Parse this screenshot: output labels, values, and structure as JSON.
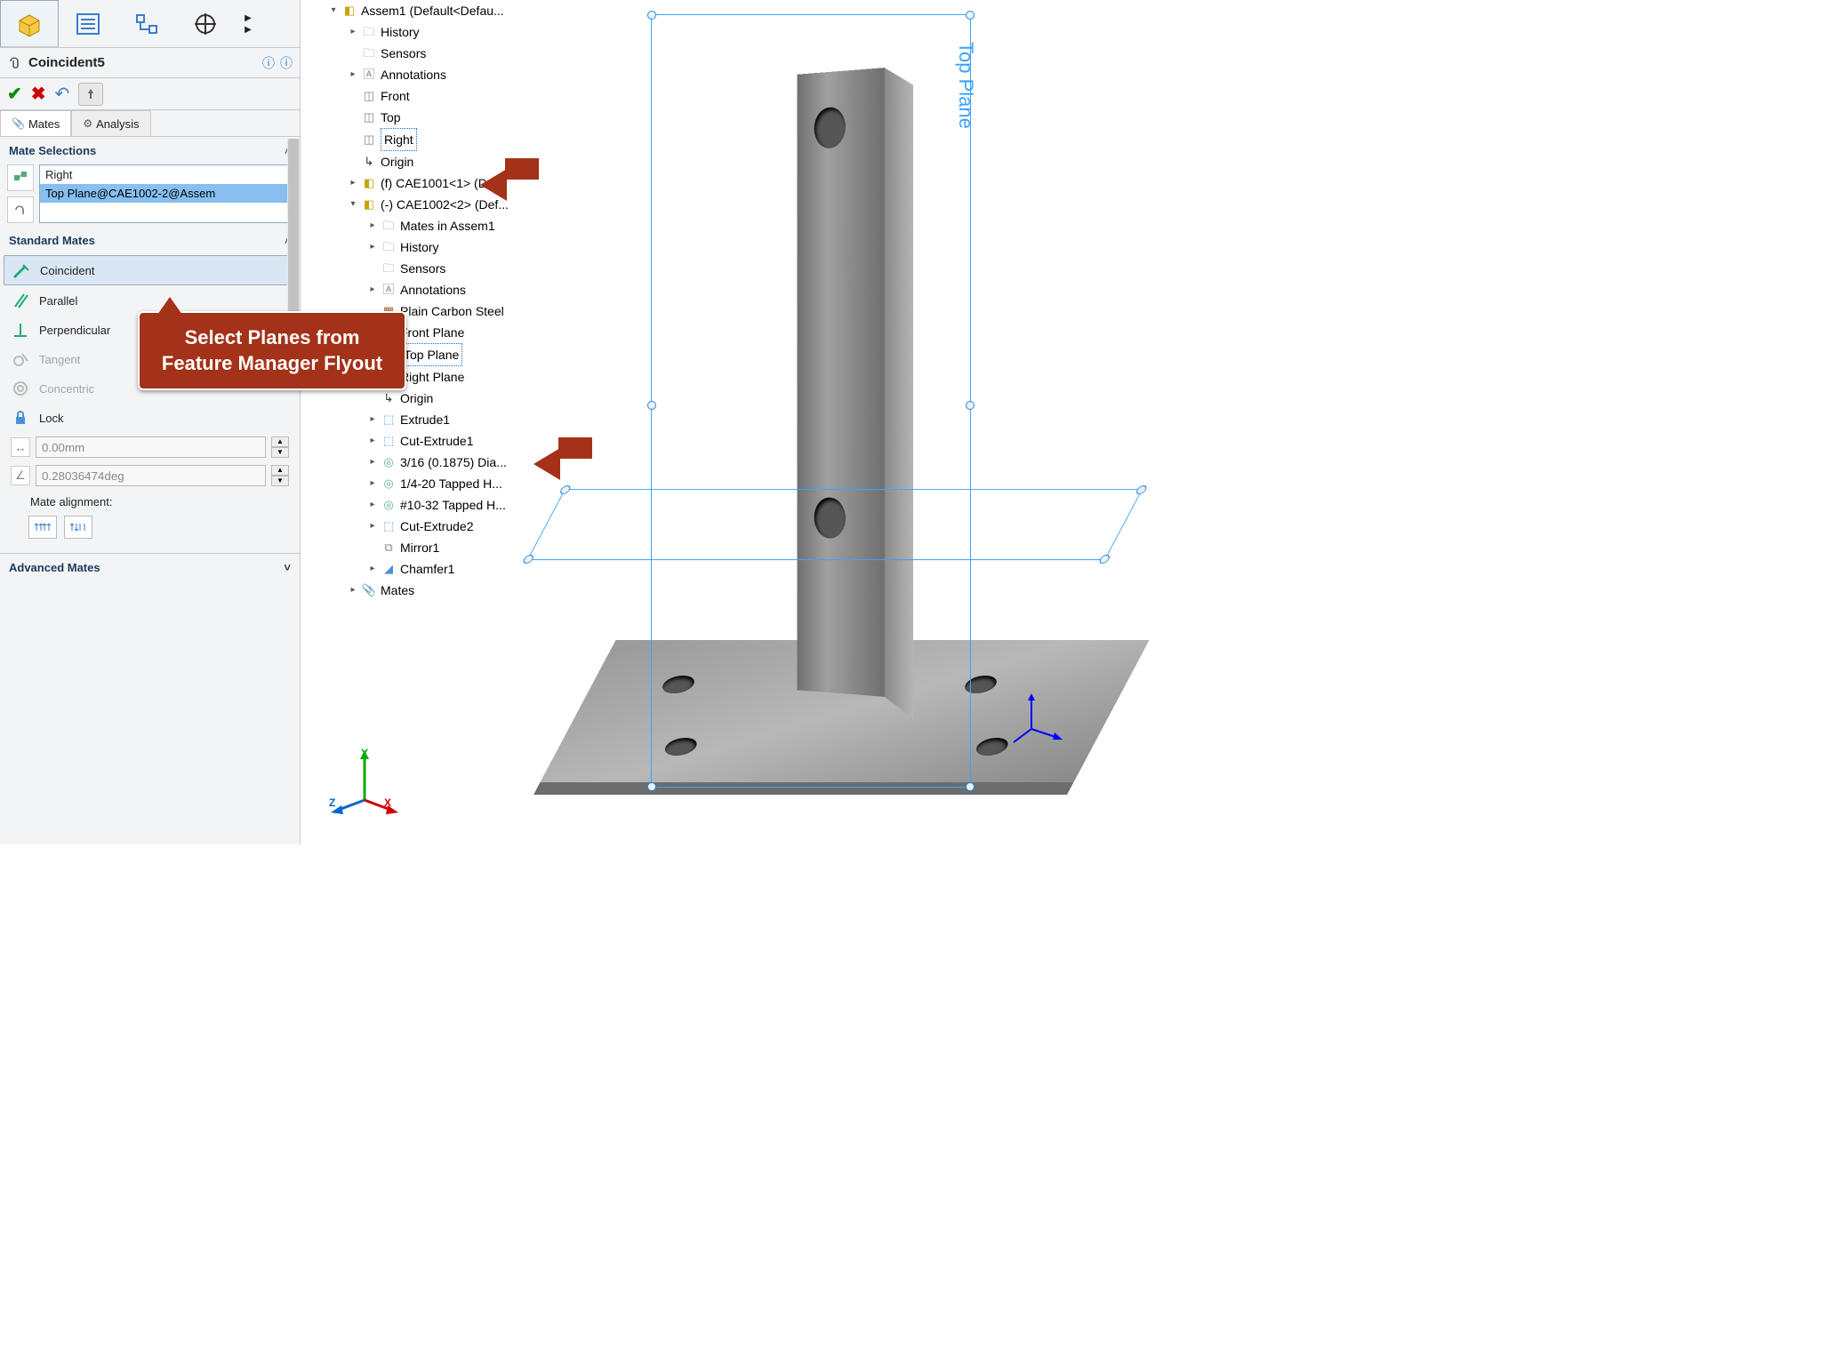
{
  "feature_title": "Coincident5",
  "subtabs": {
    "mates": "Mates",
    "analysis": "Analysis"
  },
  "sections": {
    "mate_selections": "Mate Selections",
    "standard_mates": "Standard Mates",
    "advanced_mates": "Advanced Mates",
    "mate_alignment": "Mate alignment:"
  },
  "selections": {
    "item1": "Right",
    "item2": "Top Plane@CAE1002-2@Assem"
  },
  "standard_mates": {
    "coincident": "Coincident",
    "parallel": "Parallel",
    "perpendicular": "Perpendicular",
    "tangent": "Tangent",
    "concentric": "Concentric",
    "lock": "Lock"
  },
  "params": {
    "distance": "0.00mm",
    "angle": "0.28036474deg"
  },
  "tree": {
    "root": "Assem1  (Default<Defau...",
    "history": "History",
    "sensors": "Sensors",
    "annotations": "Annotations",
    "front": "Front",
    "top": "Top",
    "right": "Right",
    "origin": "Origin",
    "part1": "(f) CAE1001<1> (Def...",
    "part2": "(-) CAE1002<2> (Def...",
    "mates_in": "Mates in Assem1",
    "p2_history": "History",
    "p2_sensors": "Sensors",
    "p2_annotations": "Annotations",
    "material": "Plain Carbon Steel",
    "front_plane": "Front Plane",
    "top_plane": "Top Plane",
    "right_plane": "Right Plane",
    "p2_origin": "Origin",
    "extrude1": "Extrude1",
    "cut_extrude1": "Cut-Extrude1",
    "hole1": "3/16 (0.1875) Dia...",
    "hole2": "1/4-20 Tapped H...",
    "hole3": "#10-32 Tapped H...",
    "cut_extrude2": "Cut-Extrude2",
    "mirror1": "Mirror1",
    "chamfer1": "Chamfer1",
    "mates": "Mates"
  },
  "callout": "Select Planes from Feature Manager Flyout",
  "plane_label": "Top Plane",
  "triad": {
    "x": "X",
    "y": "Y",
    "z": "Z"
  }
}
